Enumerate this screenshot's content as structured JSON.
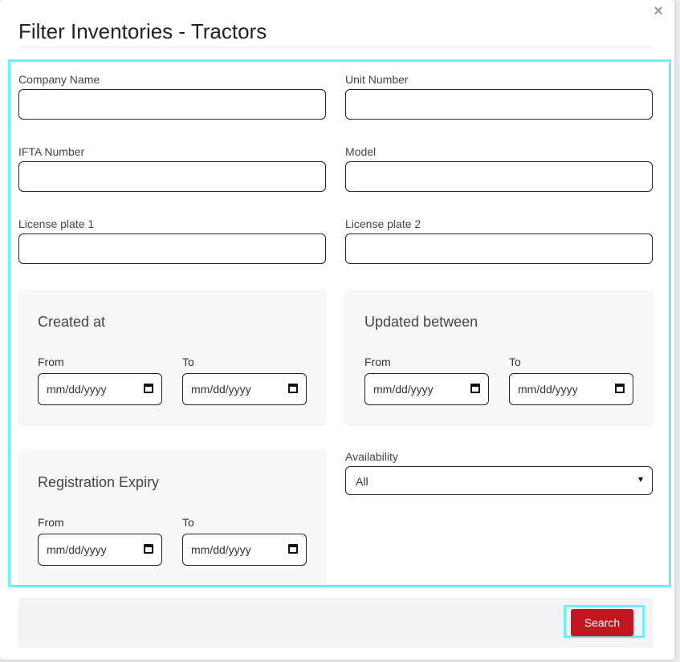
{
  "modal": {
    "title": "Filter Inventories - Tractors",
    "close_glyph": "×"
  },
  "fields": {
    "company_name_label": "Company Name",
    "unit_number_label": "Unit Number",
    "ifta_number_label": "IFTA Number",
    "model_label": "Model",
    "license_plate_1_label": "License plate 1",
    "license_plate_2_label": "License plate 2"
  },
  "date_panels": {
    "created_at": {
      "title": "Created at",
      "from_label": "From",
      "to_label": "To",
      "from_value": "mm/dd/yyyy",
      "to_value": "mm/dd/yyyy"
    },
    "updated_between": {
      "title": "Updated between",
      "from_label": "From",
      "to_label": "To",
      "from_value": "mm/dd/yyyy",
      "to_value": "mm/dd/yyyy"
    },
    "registration_expiry": {
      "title": "Registration Expiry",
      "from_label": "From",
      "to_label": "To",
      "from_value": "mm/dd/yyyy",
      "to_value": "mm/dd/yyyy"
    }
  },
  "availability": {
    "label": "Availability",
    "selected": "All"
  },
  "footer": {
    "search_label": "Search"
  },
  "colors": {
    "accent_highlight": "#6ef0f8",
    "search_button": "#c0161f"
  },
  "icons": [
    "close-icon",
    "calendar-icon",
    "chevron-down-icon"
  ]
}
